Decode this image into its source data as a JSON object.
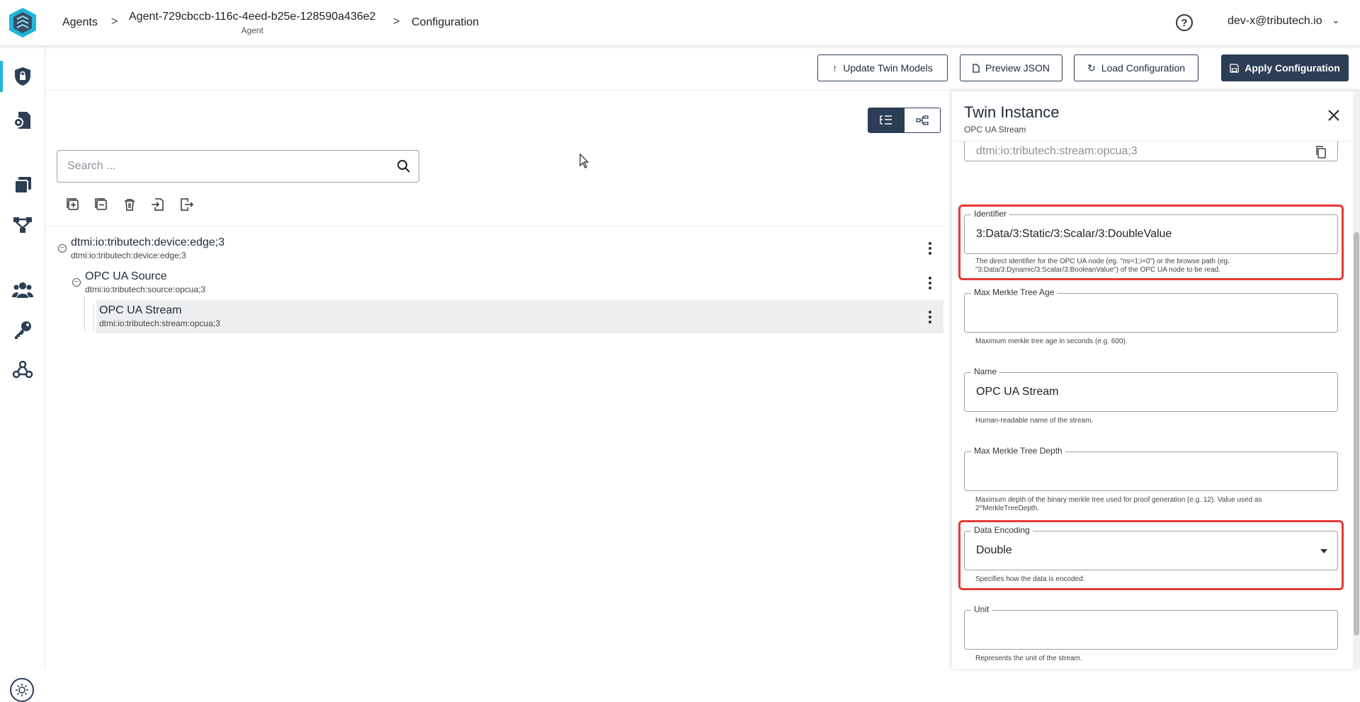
{
  "breadcrumb": {
    "agents": "Agents",
    "agent_id": "Agent-729cbccb-116c-4eed-b25e-128590a436e2",
    "agent_type": "Agent",
    "page": "Configuration",
    "separator": ">"
  },
  "header": {
    "help": "?",
    "user": "dev-x@tributech.io",
    "user_chevron": "⌄"
  },
  "toolbar": {
    "update_twin_models": "Update Twin Models",
    "preview_json": "Preview JSON",
    "load_configuration": "Load Configuration",
    "apply_configuration": "Apply Configuration"
  },
  "search": {
    "placeholder": "Search ..."
  },
  "tree": {
    "nodes": [
      {
        "title": "dtmi:io:tributech:device:edge;3",
        "dtmi": "dtmi:io:tributech:device:edge;3"
      },
      {
        "title": "OPC UA Source",
        "dtmi": "dtmi:io:tributech:source:opcua;3"
      },
      {
        "title": "OPC UA Stream",
        "dtmi": "dtmi:io:tributech:stream:opcua;3"
      }
    ],
    "toggle_symbol": "−"
  },
  "panel": {
    "title": "Twin Instance",
    "subtitle": "OPC UA Stream",
    "model_value": "dtmi:io:tributech:stream:opcua;3",
    "fields": [
      {
        "label": "Identifier",
        "value": "3:Data/3:Static/3:Scalar/3:DoubleValue",
        "hint": "The direct identifier for the OPC UA node (eg. \"ns=1;i=0\") or the browse path (eg. \"3:Data/3:Dynamic/3:Scalar/3:BooleanValue\") of the OPC UA node to be read."
      },
      {
        "label": "Max Merkle Tree Age",
        "value": "",
        "hint": "Maximum merkle tree age in seconds (e.g. 600)."
      },
      {
        "label": "Name",
        "value": "OPC UA Stream",
        "hint": "Human-readable name of the stream."
      },
      {
        "label": "Max Merkle Tree Depth",
        "value": "",
        "hint": "Maximum depth of the binary merkle tree used for proof generation (e.g. 12). Value used as 2^MerkleTreeDepth."
      },
      {
        "label": "Data Encoding",
        "value": "Double",
        "hint": "Specifies how the data is encoded."
      },
      {
        "label": "Unit",
        "value": "",
        "hint": "Represents the unit of the stream."
      }
    ]
  },
  "colors": {
    "primary": "#2c3e55",
    "accent": "#1fb6d8",
    "highlight": "#e53935",
    "selected_row": "#eceef0"
  }
}
